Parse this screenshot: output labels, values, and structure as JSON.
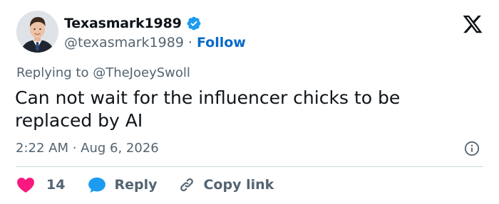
{
  "user": {
    "display_name": "Texasmark1989",
    "handle": "@texasmark1989",
    "separator": "·",
    "follow_label": "Follow",
    "verified": true,
    "avatar_icon": "user-avatar-photo"
  },
  "brand": {
    "logo_icon": "x-logo-icon"
  },
  "tweet": {
    "reply_context": "Replying to @TheJoeySwoll",
    "text": "Can not wait for the influencer chicks to be replaced by AI",
    "timestamp": "2:22 AM · Aug 6, 2026"
  },
  "actions": {
    "like_count": "14",
    "reply_label": "Reply",
    "copy_link_label": "Copy link"
  },
  "colors": {
    "text_primary": "#0f1419",
    "text_secondary": "#536471",
    "link": "#0a69c7",
    "verified_blue": "#1d9bf0",
    "like_pink": "#f91880",
    "reply_blue": "#1d9bf0",
    "divider": "#cfd9de"
  }
}
